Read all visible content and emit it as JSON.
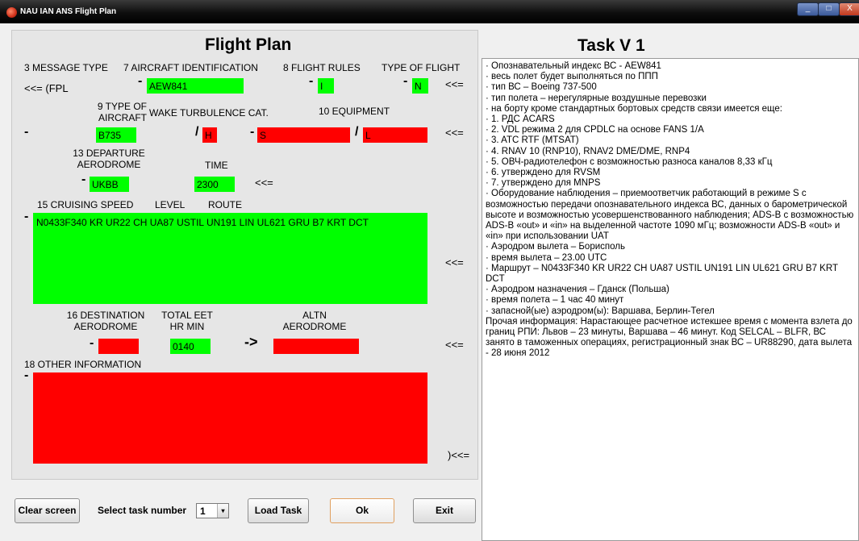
{
  "window": {
    "title": "NAU IAN ANS Flight Plan",
    "controls": [
      "_",
      "□",
      "X"
    ]
  },
  "form": {
    "title": "Flight Plan",
    "labels": {
      "message_type": "3 MESSAGE TYPE",
      "aircraft_id": "7 AIRCRAFT IDENTIFICATION",
      "flight_rules": "8  FLIGHT RULES",
      "type_of_flight": "TYPE OF FLIGHT",
      "type_of_aircraft": "9 TYPE OF\nAIRCRAFT",
      "wake_turbulence": "WAKE TURBULENCE CAT.",
      "equipment": "10 EQUIPMENT",
      "departure_aerodrome": "13 DEPARTURE\nAERODROME",
      "time": "TIME",
      "cruising_speed": "15 CRUISING SPEED",
      "level": "LEVEL",
      "route": "ROUTE",
      "destination_aerodrome": "16 DESTINATION\nAERODROME",
      "total_eet": "TOTAL EET\nHR MIN",
      "altn_aerodrome": "ALTN\nAERODROME",
      "other_information": "18 OTHER INFORMATION"
    },
    "message_prefix": "<<= (FPL",
    "dash": "-",
    "slash": "/",
    "arrow_right": "->",
    "row_end": "<<=",
    "final_end": ")<<=",
    "values": {
      "aircraft_id": "AEW841",
      "flight_rules": "I",
      "type_of_flight": "N",
      "aircraft_type": "B735",
      "wake_turbulence": "H",
      "equipment_com": "S",
      "equipment_surv": "L",
      "departure_aerodrome": "UKBB",
      "departure_time": "2300",
      "route": "N0433F340 KR UR22 CH UA87 USTIL UN191 LIN UL621 GRU B7 KRT DCT",
      "destination_aerodrome": "",
      "total_eet": "0140",
      "altn_aerodrome": "",
      "other_information": ""
    },
    "field_colors": {
      "valid": "#00ff00",
      "invalid": "#ff0000"
    }
  },
  "bottom": {
    "clear_label": "Clear screen",
    "select_label": "Select task number",
    "task_number": "1",
    "load_label": "Load Task",
    "ok_label": "Ok",
    "exit_label": "Exit"
  },
  "task": {
    "title": "Task V 1",
    "lines": [
      "· Опознавательный индекс ВС - AEW841",
      "· весь полет будет выполняться по ППП",
      "· тип ВС – Boeing 737-500",
      "· тип полета – нерегулярные воздушные перевозки",
      "· на борту кроме стандартных бортовых средств связи имеется еще:",
      "· 1. РДС ACARS",
      "· 2. VDL режима 2 для CPDLC на основе FANS 1/A",
      "· 3. ATC RTF (MTSAT)",
      "· 4. RNAV 10 (RNP10), RNAV2 DME/DME, RNP4",
      "· 5. ОВЧ-радиотелефон с возможностью разноса каналов 8,33 кГц",
      "· 6. утверждено для RVSM",
      "· 7. утверждено для MNPS",
      "· Оборудование наблюдения – приемоответчик работающий в режиме S с возможностью передачи опознавательного индекса ВС, данных о барометрической высоте и возможностью усовершенствованного наблюдения; ADS-B с возможностью ADS-B «out» и «in» на выделенной частоте 1090 мГц; возможности ADS-B «out» и «in» при использовании UAT",
      "· Аэродром вылета – Борисполь",
      "· время вылета – 23.00 UTC",
      "· Маршрут – N0433F340 KR UR22 CH UA87 USTIL UN191 LIN UL621 GRU B7 KRT DCT",
      "· Аэродром назначения – Гданск (Польша)",
      "· время полета – 1 час 40 минут",
      "· запасной(ые) аэродром(ы): Варшава, Берлин-Тегел",
      "Прочая информация: Нарастающее расчетное истекшее время с момента взлета до границ РПИ: Львов – 23 минуты, Варшава – 46 минут. Код SELCAL – BLFR, ВС занято в таможенных операциях, регистрационный знак ВС – UR88290, дата вылета  - 28 июня 2012"
    ]
  }
}
